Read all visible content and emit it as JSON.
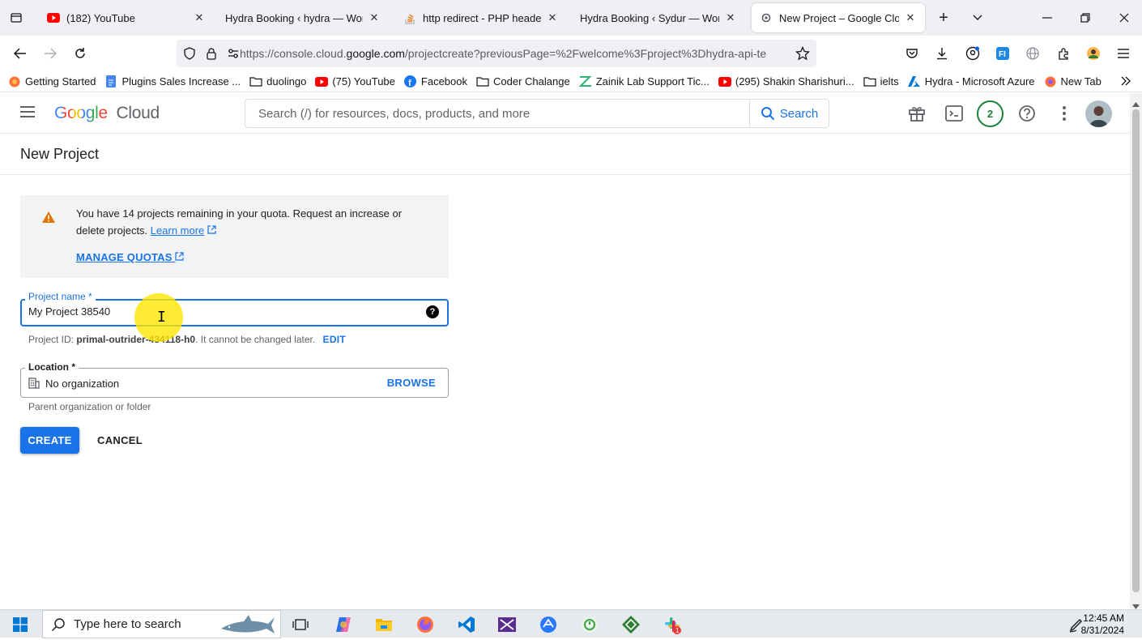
{
  "browser": {
    "tabs": [
      {
        "title": "(182) YouTube",
        "close": "✕"
      },
      {
        "title": "Hydra Booking ‹ hydra — WordP",
        "close": "✕"
      },
      {
        "title": "http redirect - PHP header(Lo",
        "close": "✕"
      },
      {
        "title": "Hydra Booking ‹ Sydur — WordP",
        "close": "✕"
      },
      {
        "title": "New Project – Google Cloud",
        "close": "✕"
      }
    ],
    "url_prefix": "https://console.cloud.",
    "url_domain": "google.com",
    "url_rest": "/projectcreate?previousPage=%2Fwelcome%3Fproject%3Dhydra-api-te",
    "bookmarks": [
      "Getting Started",
      "Plugins Sales Increase ...",
      "duolingo",
      "(75) YouTube",
      "Facebook",
      "Coder Chalange",
      "Zainik Lab Support Tic...",
      "(295) Shakin Sharishuri...",
      "ielts",
      "Hydra - Microsoft Azure",
      "New Tab"
    ]
  },
  "gcp": {
    "logo_google": "Google",
    "logo_cloud": "Cloud",
    "search_placeholder": "Search (/) for resources, docs, products, and more",
    "search_button": "Search",
    "notification_count": "2"
  },
  "page": {
    "title": "New Project",
    "quota_message": "You have 14 projects remaining in your quota. Request an increase or delete projects.",
    "learn_more": "Learn more",
    "manage_quotas": "MANAGE QUOTAS",
    "project_name_label": "Project name *",
    "project_name_value": "My Project 38540",
    "project_id_prefix": "Project ID:",
    "project_id_value": "primal-outrider-434118-h0",
    "project_id_suffix": ". It cannot be changed later.",
    "edit_label": "EDIT",
    "location_label": "Location *",
    "location_value": "No organization",
    "browse_label": "BROWSE",
    "location_help": "Parent organization or folder",
    "create_label": "CREATE",
    "cancel_label": "CANCEL"
  },
  "taskbar": {
    "search_text": "Type here to search",
    "time": "12:45 AM",
    "date": "8/31/2024"
  },
  "colors": {
    "accent": "#1a73e8",
    "warning": "#e37400",
    "quota_bg": "#f1f3f4"
  }
}
